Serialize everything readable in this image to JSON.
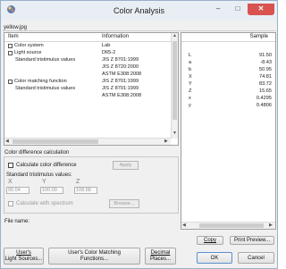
{
  "window": {
    "title": "Color Analysis",
    "min_glyph": "–",
    "max_glyph": "□",
    "close_glyph": "✕"
  },
  "filename": "yellow.jpg",
  "tree": {
    "col_item": "Item",
    "col_info": "Information",
    "rows": [
      {
        "item": "Color system",
        "info": "Lab",
        "icon": true
      },
      {
        "item": "Light source",
        "info": "D65-2",
        "icon": true
      },
      {
        "item": "Standard tristimulus values",
        "info": "JIS Z 8701:1999",
        "icon": false
      },
      {
        "item": "",
        "info": "JIS Z 8720:2000",
        "icon": false
      },
      {
        "item": "",
        "info": "ASTM E308:2008",
        "icon": false
      },
      {
        "item": "Color matching function",
        "info": "JIS Z 8701:1999",
        "icon": true
      },
      {
        "item": "Standard tristimulus values",
        "info": "JIS Z 8701:1999",
        "icon": false
      },
      {
        "item": "",
        "info": "ASTM E308:2008",
        "icon": false
      }
    ]
  },
  "diff": {
    "group_label": "Color difference calculation",
    "calc_label": "Calculate color difference",
    "apply_label": "Apply",
    "std_label": "Standard tristimulus values:",
    "x_label": "X",
    "y_label": "Y",
    "z_label": "Z",
    "x_value": "95.04",
    "y_value": "100.00",
    "z_value": "108.88",
    "spectrum_label": "Calculate with spectrum",
    "browse_label": "Browse..."
  },
  "file_name_label": "File name:",
  "buttons": {
    "light_sources_1": "User's",
    "light_sources_2": "Light Sources...",
    "cmf_1": "User's Color Matching",
    "cmf_2": "Functions...",
    "decimal_1": "Decimal",
    "decimal_2": "Places...",
    "copy": "Copy",
    "print_preview": "Print Preview...",
    "ok": "OK",
    "cancel": "Cancel"
  },
  "values": {
    "col_sample": "Sample",
    "rows": [
      {
        "key": "L",
        "value": "91.50"
      },
      {
        "key": "a",
        "value": "-8.43"
      },
      {
        "key": "b",
        "value": "50.95"
      },
      {
        "key": "X",
        "value": "74.81"
      },
      {
        "key": "Y",
        "value": "83.72"
      },
      {
        "key": "Z",
        "value": "15.65"
      },
      {
        "key": "x",
        "value": "0.4295"
      },
      {
        "key": "y",
        "value": "0.4806"
      }
    ]
  }
}
